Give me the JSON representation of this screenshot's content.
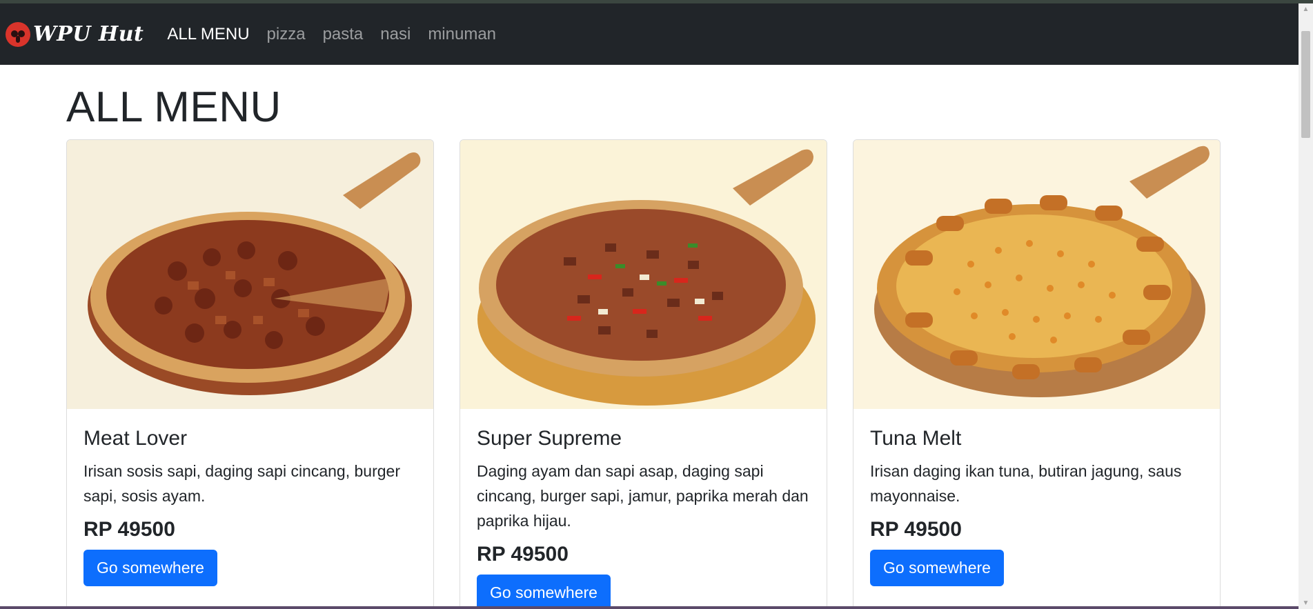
{
  "brand": {
    "name": "WPU Hut",
    "logo_icon": "pizza-hut-mascot-icon",
    "logo_color": "#d9342b"
  },
  "nav": {
    "items": [
      {
        "label": "ALL MENU",
        "active": true
      },
      {
        "label": "pizza",
        "active": false
      },
      {
        "label": "pasta",
        "active": false
      },
      {
        "label": "nasi",
        "active": false
      },
      {
        "label": "minuman",
        "active": false
      }
    ]
  },
  "page": {
    "title": "ALL MENU"
  },
  "cards": [
    {
      "image_icon": "meat-lover-pizza-image",
      "title": "Meat Lover",
      "description": "Irisan sosis sapi, daging sapi cincang, burger sapi, sosis ayam.",
      "price": "RP 49500",
      "button": "Go somewhere"
    },
    {
      "image_icon": "super-supreme-pizza-image",
      "title": "Super Supreme",
      "description": "Daging ayam dan sapi asap, daging sapi cincang, burger sapi, jamur, paprika merah dan paprika hijau.",
      "price": "RP 49500",
      "button": "Go somewhere"
    },
    {
      "image_icon": "tuna-melt-pizza-image",
      "title": "Tuna Melt",
      "description": "Irisan daging ikan tuna, butiran jagung, saus mayonnaise.",
      "price": "RP 49500",
      "button": "Go somewhere"
    }
  ],
  "colors": {
    "navbar": "#212529",
    "primary_button": "#0d6efd",
    "image_background": "#fbf4de"
  }
}
